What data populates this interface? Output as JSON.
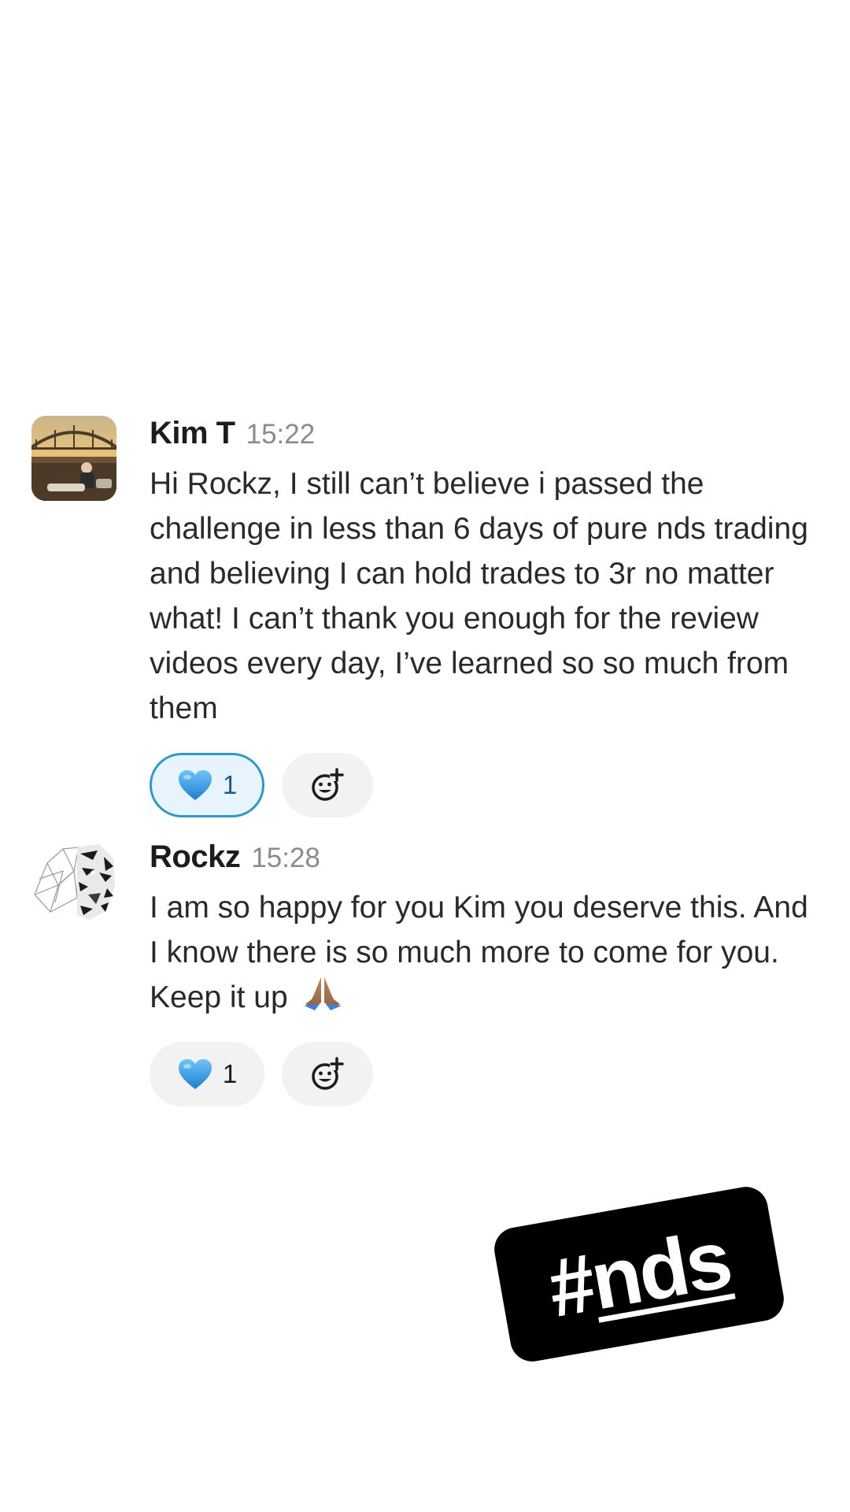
{
  "messages": [
    {
      "author": "Kim T",
      "time": "15:22",
      "text": "Hi Rockz, I still can’t believe i passed the challenge in less than 6 days of pure nds trading and believing I can hold trades to 3r no matter what! I can’t thank you enough for the review videos every day, I’ve learned so so much from them",
      "avatar": "photo-avatar",
      "reactions": [
        {
          "emoji": "💙",
          "icon": "blue-heart-icon",
          "count": "1",
          "selected": true
        }
      ],
      "add_reaction_icon": "add-reaction-icon"
    },
    {
      "author": "Rockz",
      "time": "15:28",
      "text": "I am so happy for you Kim you deserve this. And I know there is so much more to come for you. Keep it up",
      "trailing_emoji": "🙏🏽",
      "avatar": "tiger-avatar",
      "reactions": [
        {
          "emoji": "💙",
          "icon": "blue-heart-icon",
          "count": "1",
          "selected": false
        }
      ],
      "add_reaction_icon": "add-reaction-icon"
    }
  ],
  "sticker": {
    "hash": "#",
    "word": "nds"
  },
  "colors": {
    "background": "#ffffff",
    "selected_reaction_border": "#2f97c9",
    "selected_reaction_fill": "#e8f4fb",
    "reaction_fill": "#f2f2f2",
    "timestamp": "#8b8b8b",
    "sticker_bg": "#000000"
  }
}
